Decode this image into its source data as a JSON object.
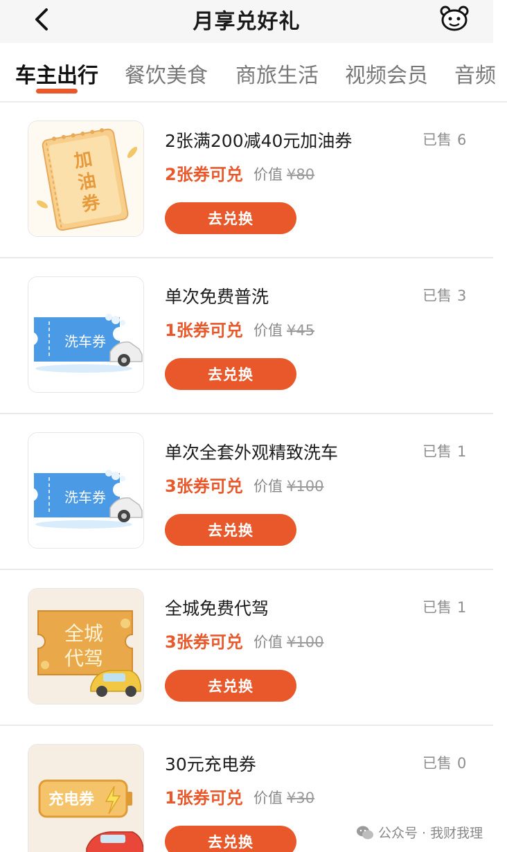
{
  "header": {
    "title": "月享兑好礼"
  },
  "tabs": [
    {
      "label": "车主出行"
    },
    {
      "label": "餐饮美食"
    },
    {
      "label": "商旅生活"
    },
    {
      "label": "视频会员"
    },
    {
      "label": "音频"
    }
  ],
  "sold_label": "已售",
  "value_label": "价值",
  "items": [
    {
      "name": "2张满200减40元加油券",
      "sold": "6",
      "need": "2张券可兑",
      "price": "¥80",
      "button": "去兑换",
      "image_text": "加油券",
      "thumb_icon": "fuel-coupon-icon"
    },
    {
      "name": "单次免费普洗",
      "sold": "3",
      "need": "1张券可兑",
      "price": "¥45",
      "button": "去兑换",
      "image_text": "洗车券",
      "thumb_icon": "car-wash-coupon-icon"
    },
    {
      "name": "单次全套外观精致洗车",
      "sold": "1",
      "need": "3张券可兑",
      "price": "¥100",
      "button": "去兑换",
      "image_text": "洗车券",
      "thumb_icon": "car-wash-coupon-icon"
    },
    {
      "name": "全城免费代驾",
      "sold": "1",
      "need": "3张券可兑",
      "price": "¥100",
      "button": "去兑换",
      "image_text": "全城 代驾",
      "thumb_icon": "designated-driver-coupon-icon"
    },
    {
      "name": "30元充电券",
      "sold": "0",
      "need": "1张券可兑",
      "price": "¥30",
      "button": "去兑换",
      "image_text": "充电券",
      "thumb_icon": "ev-charging-coupon-icon"
    }
  ],
  "watermark": "公众号 · 我财我理",
  "colors": {
    "accent": "#e8582a",
    "wash_blue": "#4a9ae6",
    "fuel_beige": "#f4d49a"
  }
}
